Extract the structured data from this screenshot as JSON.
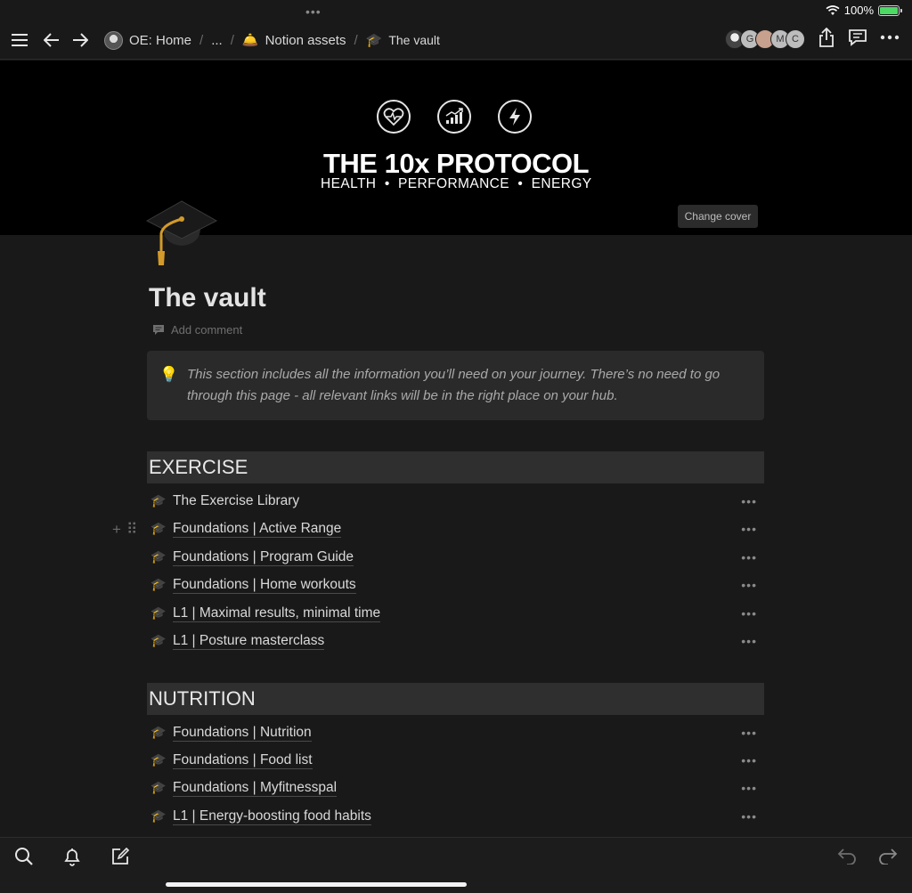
{
  "status": {
    "battery": "100%"
  },
  "breadcrumb": {
    "items": [
      {
        "label": "OE: Home",
        "icon": "avatar-photo"
      },
      {
        "label": "...",
        "icon": ""
      },
      {
        "label": "Notion assets",
        "icon": "bell-emoji"
      },
      {
        "label": "The vault",
        "icon": "graduation-cap-emoji"
      }
    ],
    "separator": "/"
  },
  "collaborators": [
    "G",
    "",
    "M",
    "C"
  ],
  "cover": {
    "title": "THE 10x PROTOCOL",
    "subtitle": "HEALTH  •  PERFORMANCE  •  ENERGY",
    "icons": [
      "heart-pulse-icon",
      "chart-up-icon",
      "lightning-icon"
    ],
    "change_cover": "Change cover"
  },
  "page": {
    "title": "The vault",
    "add_comment": "Add comment",
    "callout": "This section includes all the information you’ll need on your journey. There’s no need to go through this page - all relevant links will be in the right place on your hub."
  },
  "sections": [
    {
      "heading": "EXERCISE",
      "items": [
        "The Exercise Library",
        "Foundations | Active Range",
        "Foundations | Program Guide",
        "Foundations | Home workouts",
        "L1 | Maximal results, minimal time",
        "L1 | Posture masterclass"
      ]
    },
    {
      "heading": "NUTRITION",
      "items": [
        "Foundations | Nutrition",
        "Foundations | Food list",
        "Foundations | Myfitnesspal",
        "L1 | Energy-boosting food habits"
      ]
    }
  ],
  "colors": {
    "background": "#191919",
    "section_bg": "#2f2f2f",
    "callout_bg": "#2a2a2a",
    "battery": "#4cd964"
  }
}
